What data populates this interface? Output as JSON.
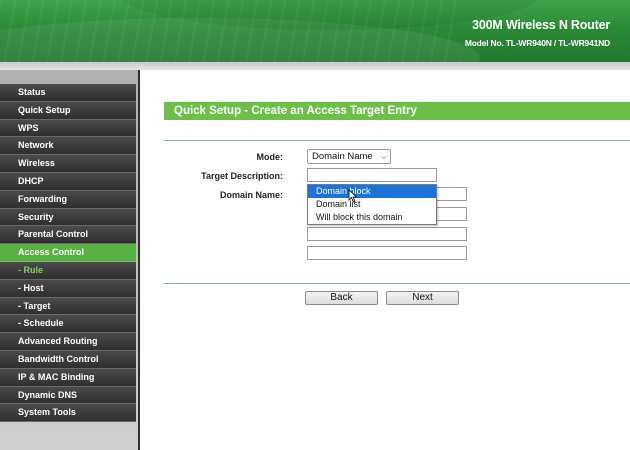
{
  "header": {
    "title": "300M Wireless N Router",
    "model": "Model No. TL-WR940N / TL-WR941ND",
    "accent": "#2b8a37"
  },
  "sidebar": {
    "items": [
      {
        "label": "Status"
      },
      {
        "label": "Quick Setup"
      },
      {
        "label": "WPS"
      },
      {
        "label": "Network"
      },
      {
        "label": "Wireless"
      },
      {
        "label": "DHCP"
      },
      {
        "label": "Forwarding"
      },
      {
        "label": "Security"
      },
      {
        "label": "Parental Control"
      },
      {
        "label": "Access Control",
        "state": "active"
      },
      {
        "label": "- Rule",
        "state": "sub-active"
      },
      {
        "label": "- Host"
      },
      {
        "label": "- Target"
      },
      {
        "label": "- Schedule"
      },
      {
        "label": "Advanced Routing"
      },
      {
        "label": "Bandwidth Control"
      },
      {
        "label": "IP & MAC Binding"
      },
      {
        "label": "Dynamic DNS"
      },
      {
        "label": "System Tools"
      }
    ],
    "active_color": "#59b143"
  },
  "main": {
    "title": "Quick Setup - Create an Access Target Entry",
    "form": {
      "mode_label": "Mode:",
      "mode_value": "Domain Name",
      "target_description_label": "Target Description:",
      "target_description_value": "",
      "domain_name_label": "Domain Name:",
      "domain_names": [
        "",
        "",
        "",
        ""
      ]
    },
    "dropdown": {
      "options": [
        "Domain block",
        "Domain list",
        "Will block this domain"
      ],
      "highlighted_index": 0,
      "highlight_color": "#1e73d8"
    },
    "buttons": {
      "back": "Back",
      "next": "Next"
    }
  }
}
